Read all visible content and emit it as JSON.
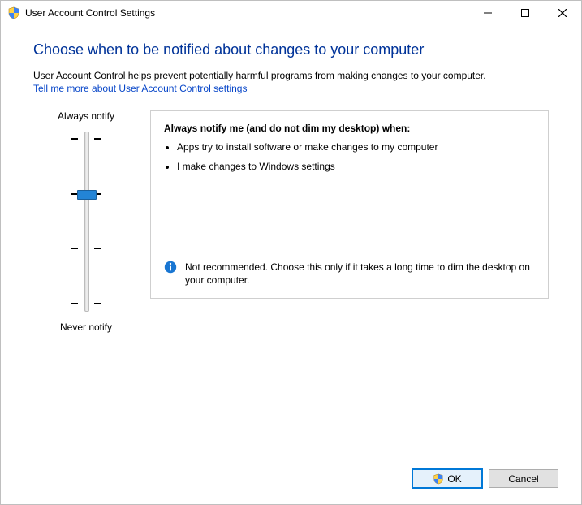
{
  "window": {
    "title": "User Account Control Settings"
  },
  "content": {
    "heading": "Choose when to be notified about changes to your computer",
    "intro": "User Account Control helps prevent potentially harmful programs from making changes to your computer.",
    "help_link": "Tell me more about User Account Control settings"
  },
  "slider": {
    "top_label": "Always notify",
    "bottom_label": "Never notify",
    "levels": 4,
    "selected_index": 1
  },
  "description": {
    "heading": "Always notify me (and do not dim my desktop) when:",
    "bullets": [
      "Apps try to install software or make changes to my computer",
      "I make changes to Windows settings"
    ],
    "note": "Not recommended. Choose this only if it takes a long time to dim the desktop on your computer."
  },
  "buttons": {
    "ok": "OK",
    "cancel": "Cancel"
  }
}
